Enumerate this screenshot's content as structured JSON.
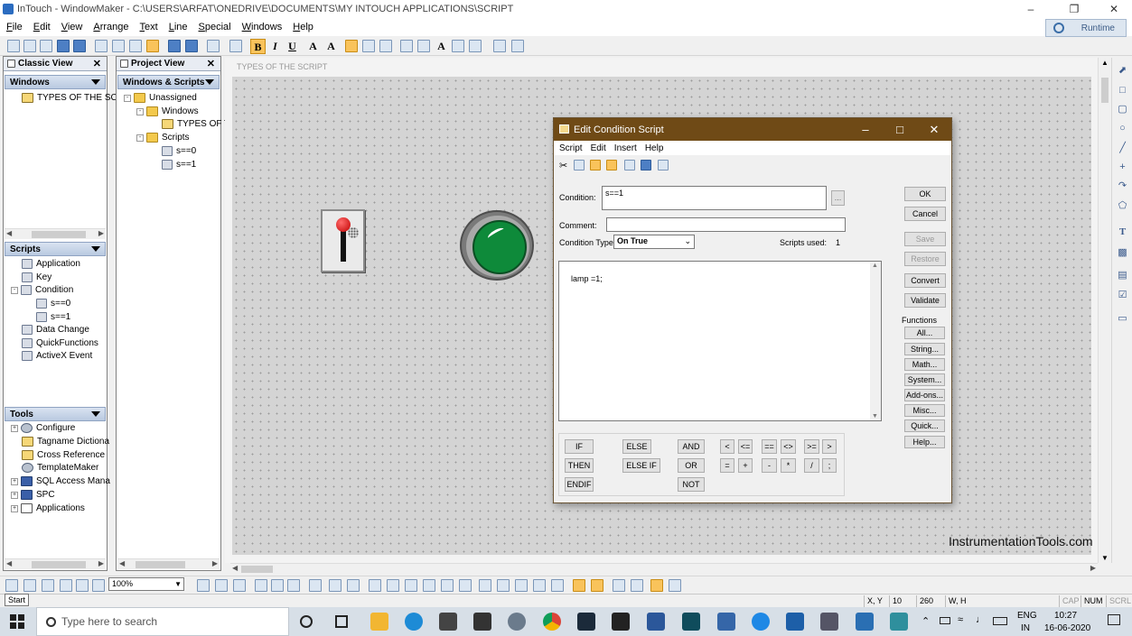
{
  "window": {
    "title": "InTouch - WindowMaker - C:\\USERS\\ARFAT\\ONEDRIVE\\DOCUMENTS\\MY INTOUCH APPLICATIONS\\SCRIPT",
    "runtime_label": "Runtime"
  },
  "menu": [
    "File",
    "Edit",
    "View",
    "Arrange",
    "Text",
    "Line",
    "Special",
    "Windows",
    "Help"
  ],
  "classic_view": {
    "title": "Classic View",
    "windows_header": "Windows",
    "windows_items": [
      "TYPES OF THE SCR"
    ],
    "scripts_header": "Scripts",
    "scripts_items": [
      "Application",
      "Key",
      "Condition",
      "s==0",
      "s==1",
      "Data Change",
      "QuickFunctions",
      "ActiveX Event"
    ],
    "tools_header": "Tools",
    "tools_items": [
      "Configure",
      "Tagname Dictiona",
      "Cross Reference",
      "TemplateMaker",
      "SQL Access Mana",
      "SPC",
      "Applications"
    ]
  },
  "project_view": {
    "title": "Project View",
    "header": "Windows & Scripts",
    "items": [
      "Unassigned",
      "Windows",
      "TYPES OF T",
      "Scripts",
      "s==0",
      "s==1"
    ]
  },
  "canvas": {
    "window_title": "TYPES OF THE SCRIPT"
  },
  "dialog": {
    "title": "Edit Condition Script",
    "menu": [
      "Script",
      "Edit",
      "Insert",
      "Help"
    ],
    "condition_label": "Condition:",
    "condition_value": "s==1",
    "browse_label": "...",
    "comment_label": "Comment:",
    "comment_value": "",
    "condition_type_label": "Condition Type:",
    "condition_type_value": "On True",
    "scripts_used_label": "Scripts used:",
    "scripts_used_value": "1",
    "script_text": "lamp =1;",
    "buttons": {
      "ok": "OK",
      "cancel": "Cancel",
      "save": "Save",
      "restore": "Restore",
      "convert": "Convert",
      "validate": "Validate"
    },
    "functions_label": "Functions",
    "functions": [
      "All...",
      "String...",
      "Math...",
      "System...",
      "Add-ons...",
      "Misc...",
      "Quick...",
      "Help..."
    ],
    "keywords": [
      "IF",
      "THEN",
      "ENDIF",
      "ELSE",
      "ELSE IF",
      "AND",
      "OR",
      "NOT"
    ],
    "operators": [
      "<",
      "<=",
      "==",
      "<>",
      ">=",
      ">",
      "=",
      "+",
      "-",
      "*",
      "/",
      ";"
    ]
  },
  "watermark": "InstrumentationTools.com",
  "zoom": "100%",
  "status": {
    "start_tip": "Start",
    "xy_label": "X, Y",
    "x": "10",
    "y": "260",
    "wh_label": "W, H",
    "caps": "CAP",
    "num": "NUM",
    "scrl": "SCRL"
  },
  "taskbar": {
    "search_placeholder": "Type here to search",
    "lang": "ENG",
    "region": "IN",
    "time": "10:27",
    "date": "16-06-2020"
  },
  "colors": {
    "dialog_title": "#6f4a16",
    "lamp_green": "#0e8a3a",
    "canvas": "#d4d4d4"
  }
}
